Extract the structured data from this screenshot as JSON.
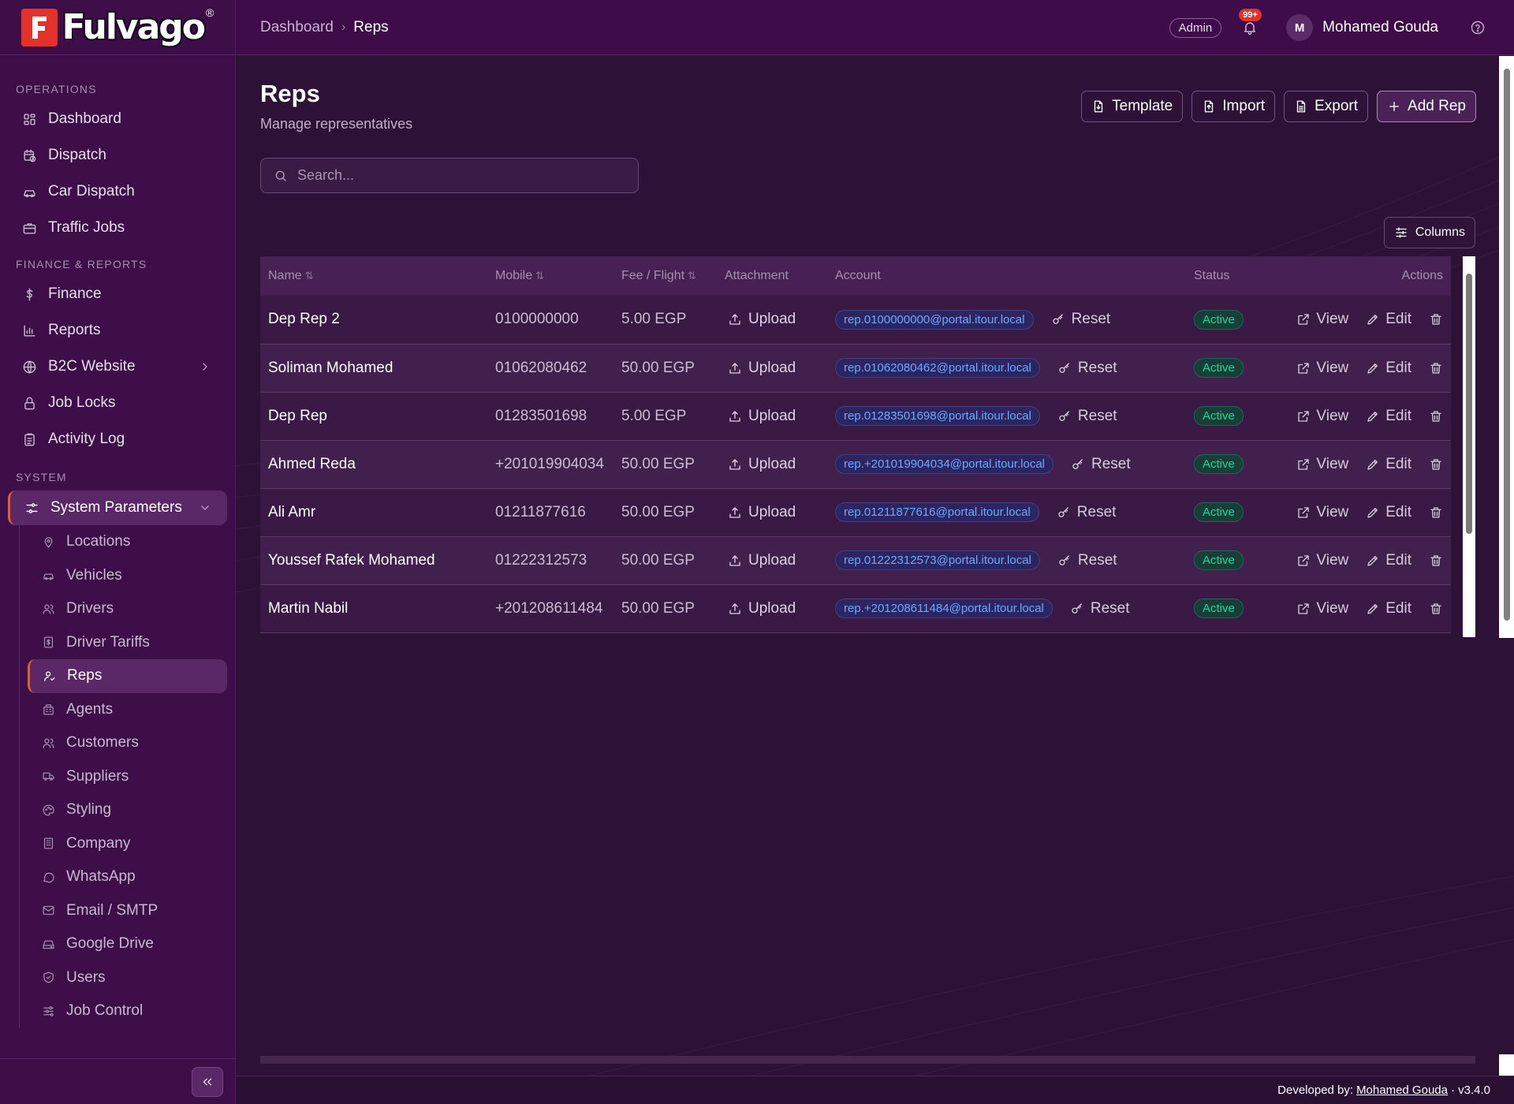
{
  "brand": {
    "name": "Fulvago",
    "reg": "®"
  },
  "sidebar": {
    "sections": {
      "operations": "OPERATIONS",
      "finance": "FINANCE & REPORTS",
      "system": "SYSTEM"
    },
    "operations": [
      {
        "label": "Dashboard",
        "icon": "dashboard-icon"
      },
      {
        "label": "Dispatch",
        "icon": "calendar-clock-icon"
      },
      {
        "label": "Car Dispatch",
        "icon": "car-icon"
      },
      {
        "label": "Traffic Jobs",
        "icon": "briefcase-icon"
      }
    ],
    "finance": [
      {
        "label": "Finance",
        "icon": "dollar-icon"
      },
      {
        "label": "Reports",
        "icon": "bar-chart-icon"
      },
      {
        "label": "B2C Website",
        "icon": "globe-icon"
      },
      {
        "label": "Job Locks",
        "icon": "lock-icon"
      },
      {
        "label": "Activity Log",
        "icon": "clipboard-icon"
      }
    ],
    "system_parent": "System Parameters",
    "system_items": [
      "Locations",
      "Vehicles",
      "Drivers",
      "Driver Tariffs",
      "Reps",
      "Agents",
      "Customers",
      "Suppliers",
      "Styling",
      "Company",
      "WhatsApp",
      "Email / SMTP",
      "Google Drive",
      "Users",
      "Job Control"
    ],
    "active_item": "Reps"
  },
  "header": {
    "breadcrumb": {
      "root": "Dashboard",
      "current": "Reps"
    },
    "role": "Admin",
    "notifications": "99+",
    "user_initial": "M",
    "user_name": "Mohamed Gouda"
  },
  "page": {
    "title": "Reps",
    "subtitle": "Manage representatives",
    "actions": {
      "template": "Template",
      "import": "Import",
      "export": "Export",
      "add": "Add Rep"
    },
    "search_placeholder": "Search...",
    "columns_button": "Columns"
  },
  "table": {
    "columns": {
      "name": "Name",
      "mobile": "Mobile",
      "fee": "Fee / Flight",
      "attachment": "Attachment",
      "account": "Account",
      "status": "Status",
      "actions": "Actions"
    },
    "action_labels": {
      "upload": "Upload",
      "reset": "Reset",
      "view": "View",
      "edit": "Edit"
    },
    "rows": [
      {
        "name": "Dep Rep 2",
        "mobile": "0100000000",
        "fee": "5.00 EGP",
        "account": "rep.0100000000@portal.itour.local",
        "status": "Active"
      },
      {
        "name": "Soliman Mohamed",
        "mobile": "01062080462",
        "fee": "50.00 EGP",
        "account": "rep.01062080462@portal.itour.local",
        "status": "Active"
      },
      {
        "name": "Dep Rep",
        "mobile": "01283501698",
        "fee": "5.00 EGP",
        "account": "rep.01283501698@portal.itour.local",
        "status": "Active"
      },
      {
        "name": "Ahmed Reda",
        "mobile": "+201019904034",
        "fee": "50.00 EGP",
        "account": "rep.+201019904034@portal.itour.local",
        "status": "Active"
      },
      {
        "name": "Ali Amr",
        "mobile": "01211877616",
        "fee": "50.00 EGP",
        "account": "rep.01211877616@portal.itour.local",
        "status": "Active"
      },
      {
        "name": "Youssef Rafek Mohamed",
        "mobile": "01222312573",
        "fee": "50.00 EGP",
        "account": "rep.01222312573@portal.itour.local",
        "status": "Active"
      },
      {
        "name": "Martin Nabil",
        "mobile": "+201208611484",
        "fee": "50.00 EGP",
        "account": "rep.+201208611484@portal.itour.local",
        "status": "Active"
      }
    ]
  },
  "footer": {
    "prefix": "Developed by:",
    "author": "Mohamed Gouda",
    "version": "· v3.4.0"
  },
  "colors": {
    "accent": "#e0612f",
    "brand_red": "#e4322b",
    "status_active": "#23d68a",
    "link": "#6ea8ff"
  }
}
